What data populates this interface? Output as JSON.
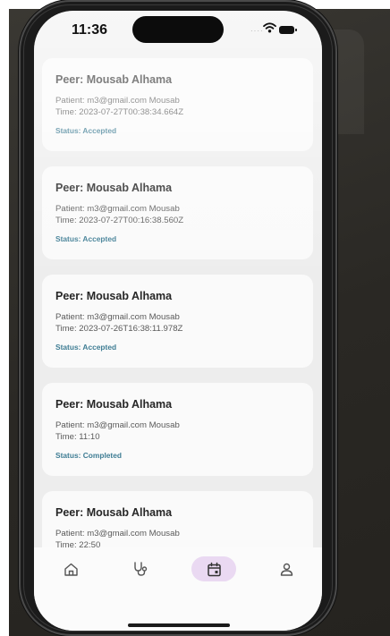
{
  "status_bar": {
    "time": "11:36",
    "signal_icon": "cell-signal-icon",
    "wifi_icon": "wifi-icon",
    "battery_icon": "battery-icon"
  },
  "sessions": [
    {
      "peer": "Peer: Mousab Alhama",
      "patient": "Patient: m3@gmail.com Mousab",
      "time": "Time: 2023-07-27T00:38:34.664Z",
      "status": "Status: Accepted"
    },
    {
      "peer": "Peer: Mousab Alhama",
      "patient": "Patient: m3@gmail.com Mousab",
      "time": "Time: 2023-07-27T00:16:38.560Z",
      "status": "Status: Accepted"
    },
    {
      "peer": "Peer: Mousab Alhama",
      "patient": "Patient: m3@gmail.com Mousab",
      "time": "Time: 2023-07-26T16:38:11.978Z",
      "status": "Status: Accepted"
    },
    {
      "peer": "Peer: Mousab Alhama",
      "patient": "Patient: m3@gmail.com Mousab",
      "time": "Time: 11:10",
      "status": "Status: Completed"
    },
    {
      "peer": "Peer: Mousab Alhama",
      "patient": "Patient: m3@gmail.com Mousab",
      "time": "Time: 22:50",
      "status": ""
    }
  ],
  "tab_bar": {
    "tabs": [
      {
        "icon": "home-icon",
        "active": false
      },
      {
        "icon": "stethoscope-icon",
        "active": false
      },
      {
        "icon": "calendar-icon",
        "active": true
      },
      {
        "icon": "profile-icon",
        "active": false
      }
    ],
    "active_color": "#ead9f2"
  },
  "colors": {
    "status_text": "#3f7d94",
    "card_background": "#fafafa",
    "screen_background": "#ededed"
  }
}
